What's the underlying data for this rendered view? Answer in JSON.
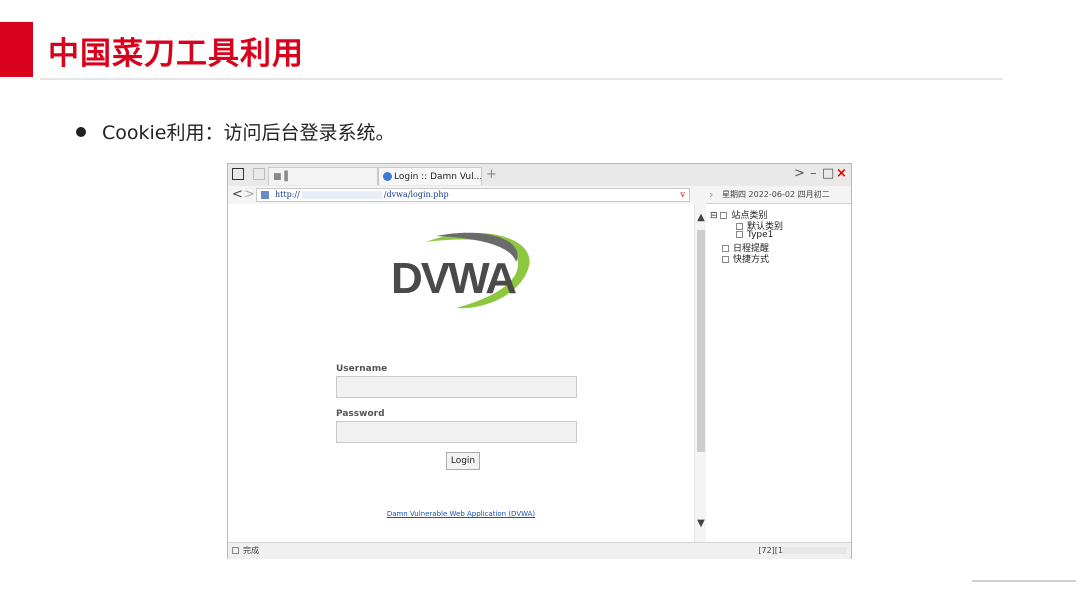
{
  "slide": {
    "title": "中国菜刀工具利用",
    "bullet": "Cookie利用：访问后台登录系统。"
  },
  "browser": {
    "tabs": [
      {
        "label": "■ ▌"
      },
      {
        "label": "Login :: Damn Vul..."
      }
    ],
    "tab_add": "+",
    "nav_back": "<",
    "nav_forward": ">",
    "url_prefix": "http://",
    "url_suffix": "/dvwa/login.php",
    "url_dropdown": "v",
    "window_controls": {
      "arrow": ">",
      "minimize": "–",
      "maximize": "□",
      "close": "×"
    },
    "page": {
      "logo_text": "DVWA",
      "username_label": "Username",
      "username_value": "",
      "password_label": "Password",
      "password_value": "",
      "login_button": "Login",
      "footer_link": "Damn Vulnerable Web Application (DVWA)"
    },
    "side_panel": {
      "date": "星期四 2022-06-02 四月初二",
      "items": [
        {
          "label": "站点类别"
        },
        {
          "label": "默认类别"
        },
        {
          "label": "Type1"
        },
        {
          "label": "日程提醒"
        },
        {
          "label": "快捷方式"
        }
      ],
      "expand": "⊟"
    },
    "status": {
      "left": "完成",
      "right": "[72][1"
    },
    "colors": {
      "brand": "#d9001b",
      "logo_swoosh": "#8dc63f",
      "link": "#1a4fbf"
    }
  }
}
